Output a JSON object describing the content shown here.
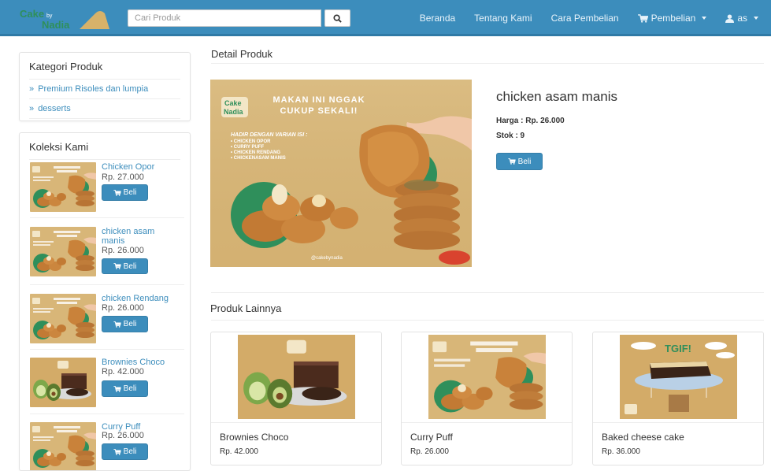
{
  "brand": {
    "line1": "Cake",
    "line2": "Nadia",
    "badge": "by"
  },
  "search": {
    "placeholder": "Cari Produk",
    "icon": "search-icon"
  },
  "nav": {
    "beranda": "Beranda",
    "tentang": "Tentang Kami",
    "cara": "Cara Pembelian",
    "pembelian": "Pembelian",
    "user": "as"
  },
  "kategori": {
    "title": "Kategori Produk",
    "items": [
      {
        "label": "Premium Risoles dan lumpia"
      },
      {
        "label": "desserts"
      }
    ]
  },
  "koleksi": {
    "title": "Koleksi Kami",
    "items": [
      {
        "name": "Chicken Opor",
        "price": "Rp. 27.000",
        "image": "risoles-poster"
      },
      {
        "name": "chicken asam manis",
        "price": "Rp. 26.000",
        "image": "risoles-poster"
      },
      {
        "name": "chicken Rendang",
        "price": "Rp. 26.000",
        "image": "risoles-poster"
      },
      {
        "name": "Brownies Choco",
        "price": "Rp. 42.000",
        "image": "brownies-photo"
      },
      {
        "name": "Curry Puff",
        "price": "Rp. 26.000",
        "image": "risoles-poster"
      }
    ]
  },
  "buy_label": "Beli",
  "detail": {
    "section_title": "Detail Produk",
    "name": "chicken asam manis",
    "harga": "Harga : Rp. 26.000",
    "stok": "Stok : 9",
    "poster": {
      "headline1": "MAKAN INI NGGAK",
      "headline2": "CUKUP SEKALI!",
      "varian_title": "HADIR DENGAN VARIAN ISI :",
      "varian": [
        "• CHICKEN OPOR",
        "• CURRY PUFF",
        "• CHICKEN RENDANG",
        "• CHICKENASAM MANIS"
      ],
      "ig": "@cakebynadia"
    }
  },
  "lainnya": {
    "section_title": "Produk Lainnya",
    "items": [
      {
        "name": "Brownies Choco",
        "price": "Rp. 42.000",
        "image": "brownies-photo"
      },
      {
        "name": "Curry Puff",
        "price": "Rp. 26.000",
        "image": "risoles-poster"
      },
      {
        "name": "Baked cheese cake",
        "price": "Rp. 36.000",
        "image": "tgif-cake"
      }
    ],
    "tgif": "TGIF!"
  },
  "colors": {
    "primary": "#3c8dbc",
    "poster_bg": "#d8b678",
    "accent_green": "#2f8f5b"
  }
}
